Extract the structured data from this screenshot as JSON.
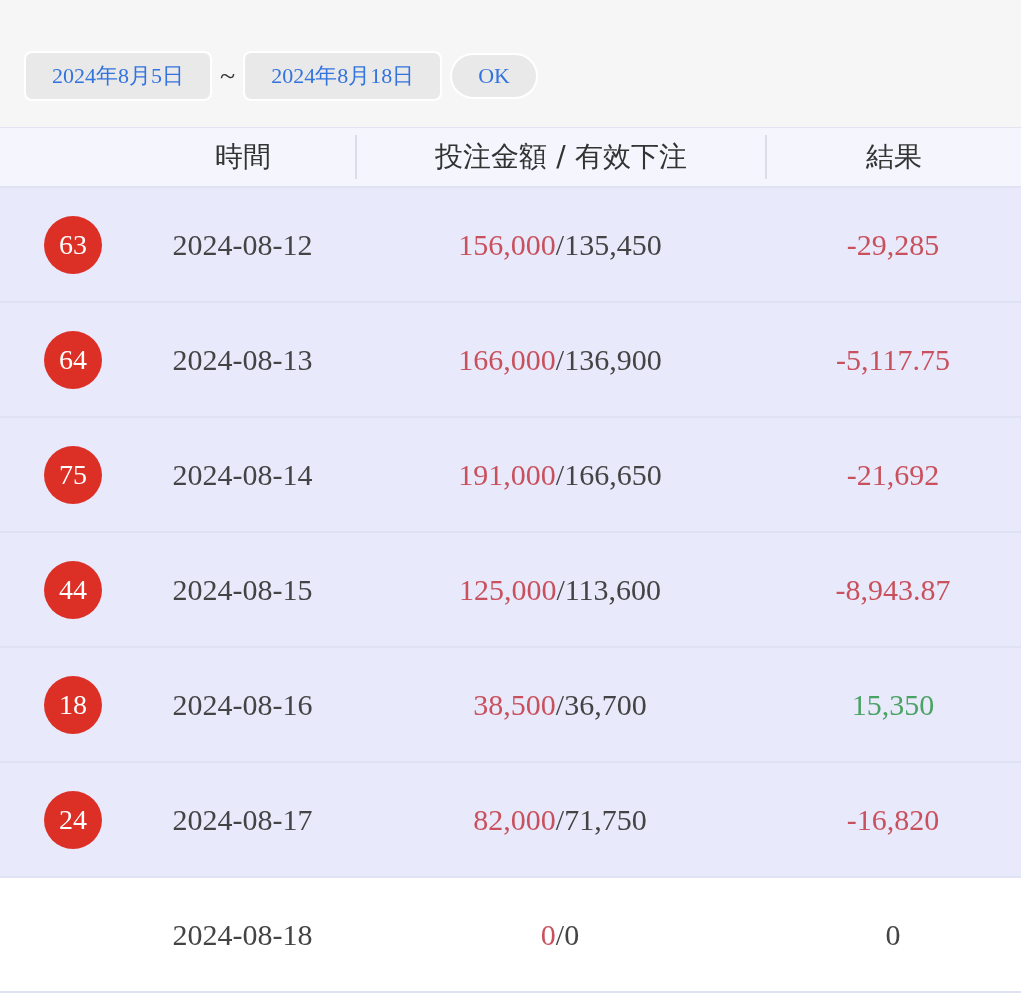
{
  "filter": {
    "start_date": "2024年8月5日",
    "separator": "~",
    "end_date": "2024年8月18日",
    "ok_button": "OK"
  },
  "table": {
    "columns": [
      "時間",
      "投注金額 / 有效下注",
      "結果"
    ],
    "rows": [
      {
        "badge": "63",
        "date": "2024-08-12",
        "bet": "156,000",
        "valid": "/135,450",
        "result": "-29,285",
        "kind": "loss",
        "highlighted": true
      },
      {
        "badge": "64",
        "date": "2024-08-13",
        "bet": "166,000",
        "valid": "/136,900",
        "result": "-5,117.75",
        "kind": "loss",
        "highlighted": true
      },
      {
        "badge": "75",
        "date": "2024-08-14",
        "bet": "191,000",
        "valid": "/166,650",
        "result": "-21,692",
        "kind": "loss",
        "highlighted": true
      },
      {
        "badge": "44",
        "date": "2024-08-15",
        "bet": "125,000",
        "valid": "/113,600",
        "result": "-8,943.87",
        "kind": "loss",
        "highlighted": true
      },
      {
        "badge": "18",
        "date": "2024-08-16",
        "bet": "38,500",
        "valid": "/36,700",
        "result": "15,350",
        "kind": "win",
        "highlighted": true
      },
      {
        "badge": "24",
        "date": "2024-08-17",
        "bet": "82,000",
        "valid": "/71,750",
        "result": "-16,820",
        "kind": "loss",
        "highlighted": true
      },
      {
        "date": "2024-08-18",
        "bet": "0",
        "valid": "/0",
        "result": "0",
        "kind": "zero",
        "highlighted": false
      }
    ]
  }
}
